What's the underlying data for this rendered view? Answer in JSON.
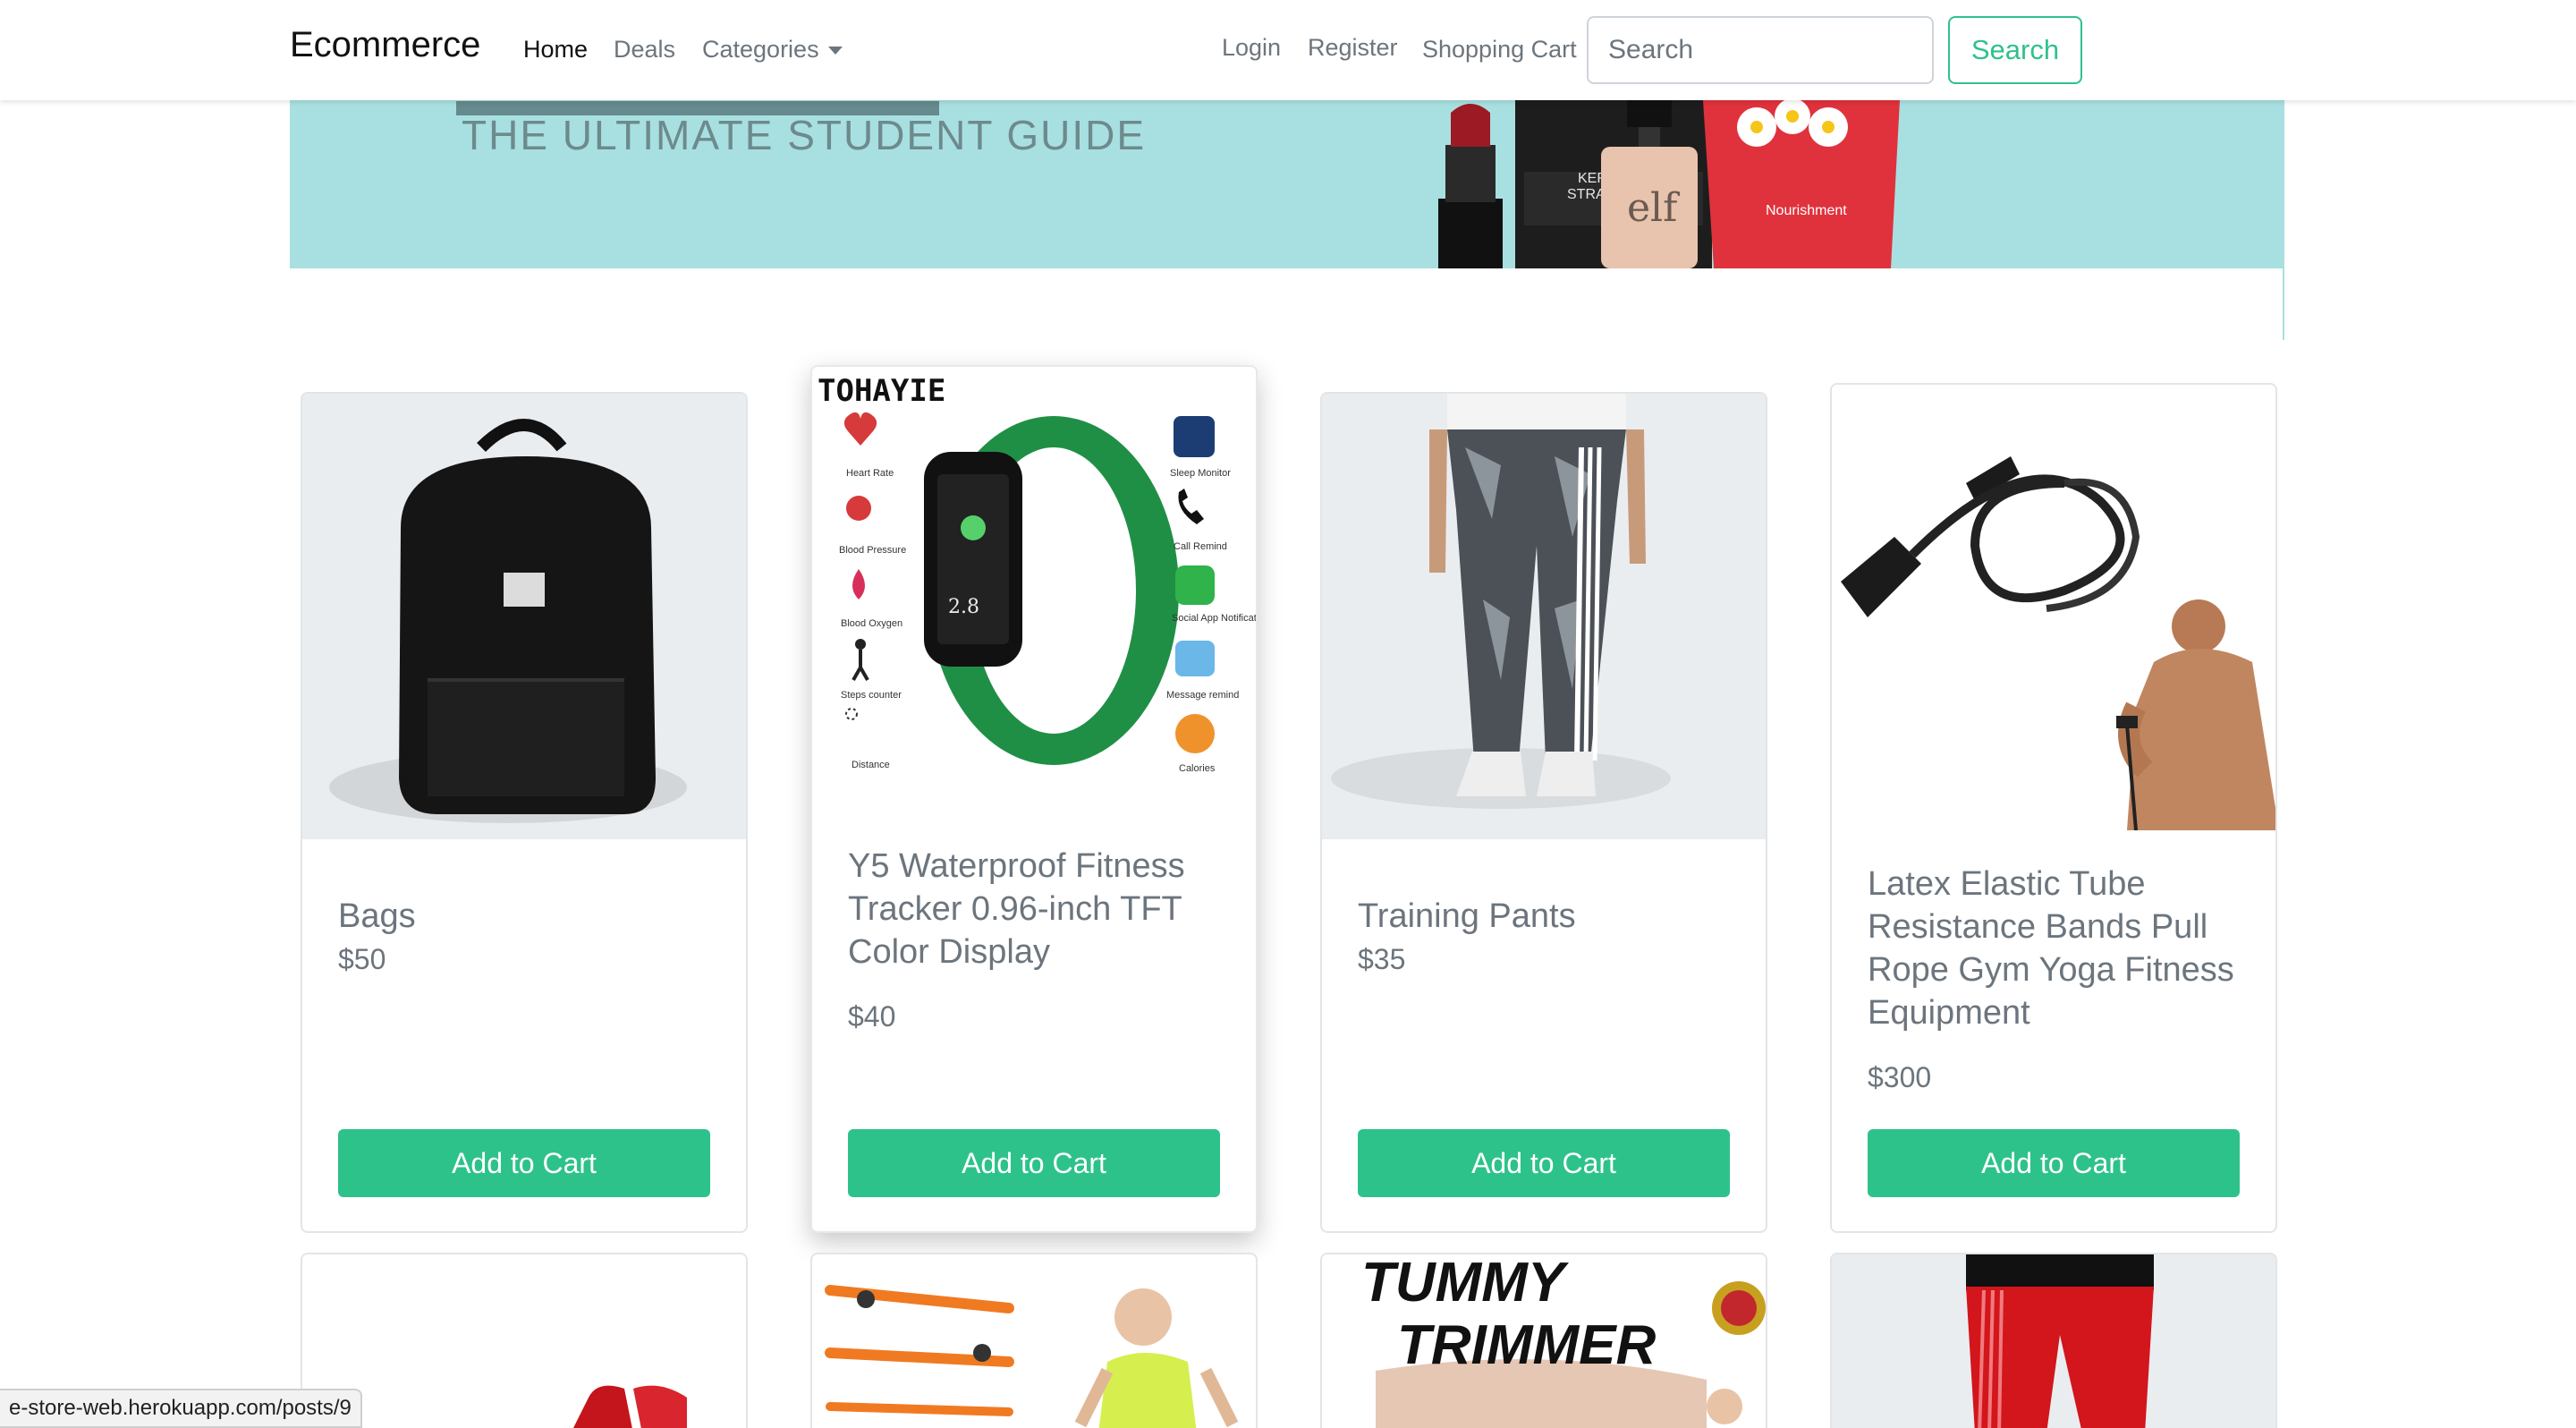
{
  "navbar": {
    "brand": "Ecommerce",
    "links": [
      "Home",
      "Deals",
      "Categories"
    ],
    "right_links": [
      "Login",
      "Register",
      "Shopping Cart"
    ],
    "search_placeholder": "Search",
    "search_button": "Search"
  },
  "banner": {
    "subtitle": "THE ULTIMATE STUDENT GUIDE",
    "product_labels": [
      "KERATIN",
      "STRAIGHTEN",
      "elf",
      "Nourishment"
    ]
  },
  "products": [
    {
      "title": "Bags",
      "price": "$50",
      "button": "Add to Cart",
      "image": "backpack"
    },
    {
      "title": "Y5 Waterproof Fitness Tracker 0.96-inch TFT Color Display",
      "price": "$40",
      "button": "Add to Cart",
      "image": "fitness-tracker",
      "image_text": {
        "brand": "TOHAYIE",
        "left_features": [
          "Heart Rate",
          "Blood Pressure",
          "Blood Oxygen",
          "Steps counter",
          "Distance"
        ],
        "right_features": [
          "Sleep Monitor",
          "Call Remind",
          "Social App Notification",
          "Message remind",
          "Calories"
        ],
        "screen": "2.8"
      }
    },
    {
      "title": "Training Pants",
      "price": "$35",
      "button": "Add to Cart",
      "image": "training-pants"
    },
    {
      "title": "Latex Elastic Tube Resistance Bands Pull Rope Gym Yoga Fitness Equipment",
      "price": "$300",
      "button": "Add to Cart",
      "image": "resistance-bands"
    }
  ],
  "second_row": [
    {
      "image": "red-item"
    },
    {
      "image": "exercise-bar"
    },
    {
      "image": "tummy-trimmer",
      "text": "TUMMY TRIMMER"
    },
    {
      "image": "red-pants"
    }
  ],
  "status_url": "e-store-web.herokuapp.com/posts/9",
  "colors": {
    "accent": "#2ec28b",
    "banner": "#a8e0e1"
  }
}
